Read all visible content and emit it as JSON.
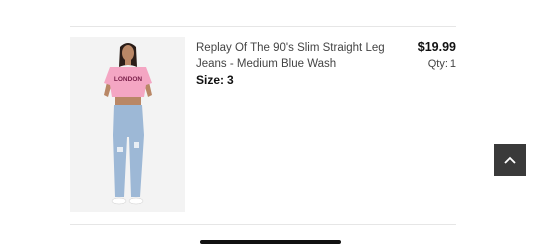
{
  "cart_item": {
    "name": "Replay Of The 90's Slim Straight Leg Jeans - Medium Blue Wash",
    "size_label": "Size:",
    "size_value": "3",
    "price": "$19.99",
    "qty_label": "Qty:",
    "qty_value": "1",
    "image_shirt_text": "LONDON"
  },
  "icons": {
    "scroll_top": "chevron-up-icon"
  },
  "colors": {
    "scroll_button_bg": "#3a3a3a",
    "shirt_pink": "#f4a6c3",
    "jeans_blue": "#9db8d6"
  }
}
